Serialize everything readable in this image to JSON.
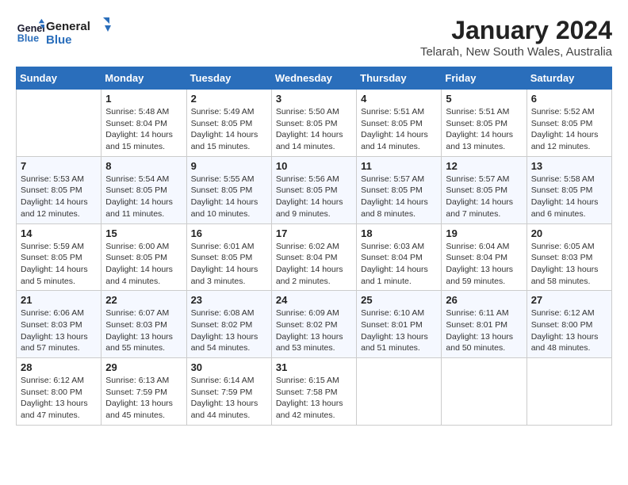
{
  "logo": {
    "text_general": "General",
    "text_blue": "Blue"
  },
  "header": {
    "month_title": "January 2024",
    "location": "Telarah, New South Wales, Australia"
  },
  "days": [
    "Sunday",
    "Monday",
    "Tuesday",
    "Wednesday",
    "Thursday",
    "Friday",
    "Saturday"
  ],
  "weeks": [
    [
      {
        "date": "",
        "sunrise": "",
        "sunset": "",
        "daylight": ""
      },
      {
        "date": "1",
        "sunrise": "Sunrise: 5:48 AM",
        "sunset": "Sunset: 8:04 PM",
        "daylight": "Daylight: 14 hours and 15 minutes."
      },
      {
        "date": "2",
        "sunrise": "Sunrise: 5:49 AM",
        "sunset": "Sunset: 8:05 PM",
        "daylight": "Daylight: 14 hours and 15 minutes."
      },
      {
        "date": "3",
        "sunrise": "Sunrise: 5:50 AM",
        "sunset": "Sunset: 8:05 PM",
        "daylight": "Daylight: 14 hours and 14 minutes."
      },
      {
        "date": "4",
        "sunrise": "Sunrise: 5:51 AM",
        "sunset": "Sunset: 8:05 PM",
        "daylight": "Daylight: 14 hours and 14 minutes."
      },
      {
        "date": "5",
        "sunrise": "Sunrise: 5:51 AM",
        "sunset": "Sunset: 8:05 PM",
        "daylight": "Daylight: 14 hours and 13 minutes."
      },
      {
        "date": "6",
        "sunrise": "Sunrise: 5:52 AM",
        "sunset": "Sunset: 8:05 PM",
        "daylight": "Daylight: 14 hours and 12 minutes."
      }
    ],
    [
      {
        "date": "7",
        "sunrise": "Sunrise: 5:53 AM",
        "sunset": "Sunset: 8:05 PM",
        "daylight": "Daylight: 14 hours and 12 minutes."
      },
      {
        "date": "8",
        "sunrise": "Sunrise: 5:54 AM",
        "sunset": "Sunset: 8:05 PM",
        "daylight": "Daylight: 14 hours and 11 minutes."
      },
      {
        "date": "9",
        "sunrise": "Sunrise: 5:55 AM",
        "sunset": "Sunset: 8:05 PM",
        "daylight": "Daylight: 14 hours and 10 minutes."
      },
      {
        "date": "10",
        "sunrise": "Sunrise: 5:56 AM",
        "sunset": "Sunset: 8:05 PM",
        "daylight": "Daylight: 14 hours and 9 minutes."
      },
      {
        "date": "11",
        "sunrise": "Sunrise: 5:57 AM",
        "sunset": "Sunset: 8:05 PM",
        "daylight": "Daylight: 14 hours and 8 minutes."
      },
      {
        "date": "12",
        "sunrise": "Sunrise: 5:57 AM",
        "sunset": "Sunset: 8:05 PM",
        "daylight": "Daylight: 14 hours and 7 minutes."
      },
      {
        "date": "13",
        "sunrise": "Sunrise: 5:58 AM",
        "sunset": "Sunset: 8:05 PM",
        "daylight": "Daylight: 14 hours and 6 minutes."
      }
    ],
    [
      {
        "date": "14",
        "sunrise": "Sunrise: 5:59 AM",
        "sunset": "Sunset: 8:05 PM",
        "daylight": "Daylight: 14 hours and 5 minutes."
      },
      {
        "date": "15",
        "sunrise": "Sunrise: 6:00 AM",
        "sunset": "Sunset: 8:05 PM",
        "daylight": "Daylight: 14 hours and 4 minutes."
      },
      {
        "date": "16",
        "sunrise": "Sunrise: 6:01 AM",
        "sunset": "Sunset: 8:05 PM",
        "daylight": "Daylight: 14 hours and 3 minutes."
      },
      {
        "date": "17",
        "sunrise": "Sunrise: 6:02 AM",
        "sunset": "Sunset: 8:04 PM",
        "daylight": "Daylight: 14 hours and 2 minutes."
      },
      {
        "date": "18",
        "sunrise": "Sunrise: 6:03 AM",
        "sunset": "Sunset: 8:04 PM",
        "daylight": "Daylight: 14 hours and 1 minute."
      },
      {
        "date": "19",
        "sunrise": "Sunrise: 6:04 AM",
        "sunset": "Sunset: 8:04 PM",
        "daylight": "Daylight: 13 hours and 59 minutes."
      },
      {
        "date": "20",
        "sunrise": "Sunrise: 6:05 AM",
        "sunset": "Sunset: 8:03 PM",
        "daylight": "Daylight: 13 hours and 58 minutes."
      }
    ],
    [
      {
        "date": "21",
        "sunrise": "Sunrise: 6:06 AM",
        "sunset": "Sunset: 8:03 PM",
        "daylight": "Daylight: 13 hours and 57 minutes."
      },
      {
        "date": "22",
        "sunrise": "Sunrise: 6:07 AM",
        "sunset": "Sunset: 8:03 PM",
        "daylight": "Daylight: 13 hours and 55 minutes."
      },
      {
        "date": "23",
        "sunrise": "Sunrise: 6:08 AM",
        "sunset": "Sunset: 8:02 PM",
        "daylight": "Daylight: 13 hours and 54 minutes."
      },
      {
        "date": "24",
        "sunrise": "Sunrise: 6:09 AM",
        "sunset": "Sunset: 8:02 PM",
        "daylight": "Daylight: 13 hours and 53 minutes."
      },
      {
        "date": "25",
        "sunrise": "Sunrise: 6:10 AM",
        "sunset": "Sunset: 8:01 PM",
        "daylight": "Daylight: 13 hours and 51 minutes."
      },
      {
        "date": "26",
        "sunrise": "Sunrise: 6:11 AM",
        "sunset": "Sunset: 8:01 PM",
        "daylight": "Daylight: 13 hours and 50 minutes."
      },
      {
        "date": "27",
        "sunrise": "Sunrise: 6:12 AM",
        "sunset": "Sunset: 8:00 PM",
        "daylight": "Daylight: 13 hours and 48 minutes."
      }
    ],
    [
      {
        "date": "28",
        "sunrise": "Sunrise: 6:12 AM",
        "sunset": "Sunset: 8:00 PM",
        "daylight": "Daylight: 13 hours and 47 minutes."
      },
      {
        "date": "29",
        "sunrise": "Sunrise: 6:13 AM",
        "sunset": "Sunset: 7:59 PM",
        "daylight": "Daylight: 13 hours and 45 minutes."
      },
      {
        "date": "30",
        "sunrise": "Sunrise: 6:14 AM",
        "sunset": "Sunset: 7:59 PM",
        "daylight": "Daylight: 13 hours and 44 minutes."
      },
      {
        "date": "31",
        "sunrise": "Sunrise: 6:15 AM",
        "sunset": "Sunset: 7:58 PM",
        "daylight": "Daylight: 13 hours and 42 minutes."
      },
      {
        "date": "",
        "sunrise": "",
        "sunset": "",
        "daylight": ""
      },
      {
        "date": "",
        "sunrise": "",
        "sunset": "",
        "daylight": ""
      },
      {
        "date": "",
        "sunrise": "",
        "sunset": "",
        "daylight": ""
      }
    ]
  ]
}
